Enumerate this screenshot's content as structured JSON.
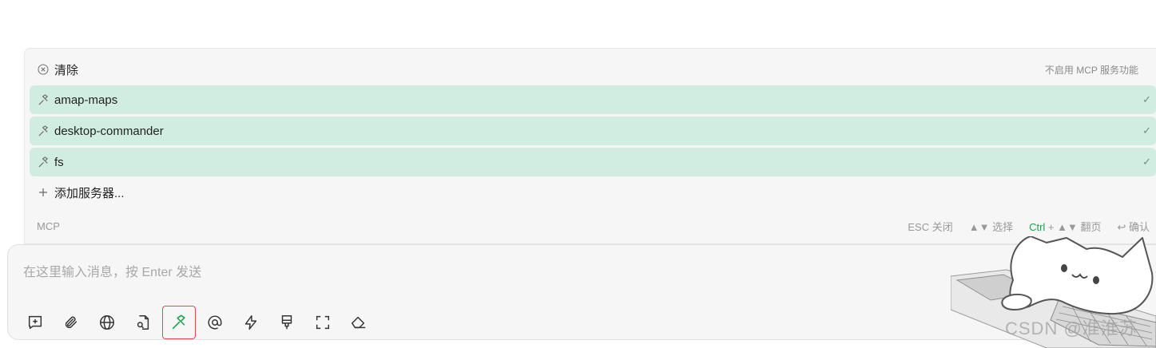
{
  "mcp_menu": {
    "clear": {
      "label": "清除",
      "hint": "不启用 MCP 服务功能",
      "icon": "circle-x-icon"
    },
    "servers": [
      {
        "label": "amap-maps",
        "selected": true,
        "icon": "hammer-icon"
      },
      {
        "label": "desktop-commander",
        "selected": true,
        "icon": "hammer-icon"
      },
      {
        "label": "fs",
        "selected": true,
        "icon": "hammer-icon"
      }
    ],
    "check_mark": "✓",
    "add_server": {
      "label": "添加服务器...",
      "icon": "plus-icon"
    },
    "footer": {
      "title": "MCP",
      "esc": "ESC 关闭",
      "select": "▲▼ 选择",
      "ctrl": "Ctrl",
      "page": "+ ▲▼ 翻页",
      "confirm": "↩ 确认"
    }
  },
  "composer": {
    "placeholder": "在这里输入消息，按 Enter 发送",
    "toolbar": [
      {
        "name": "new-topic-icon",
        "active": false
      },
      {
        "name": "paperclip-icon",
        "active": false
      },
      {
        "name": "globe-icon",
        "active": false
      },
      {
        "name": "file-search-icon",
        "active": false
      },
      {
        "name": "hammer-icon",
        "active": true
      },
      {
        "name": "at-icon",
        "active": false
      },
      {
        "name": "lightning-icon",
        "active": false
      },
      {
        "name": "paintbrush-icon",
        "active": false
      },
      {
        "name": "fullscreen-icon",
        "active": false
      },
      {
        "name": "eraser-icon",
        "active": false
      }
    ]
  },
  "watermark": "CSDN @准淮苏",
  "colors": {
    "selected_row": "#d1ede1",
    "accent": "#16a34a",
    "active_border": "#e5484d"
  }
}
